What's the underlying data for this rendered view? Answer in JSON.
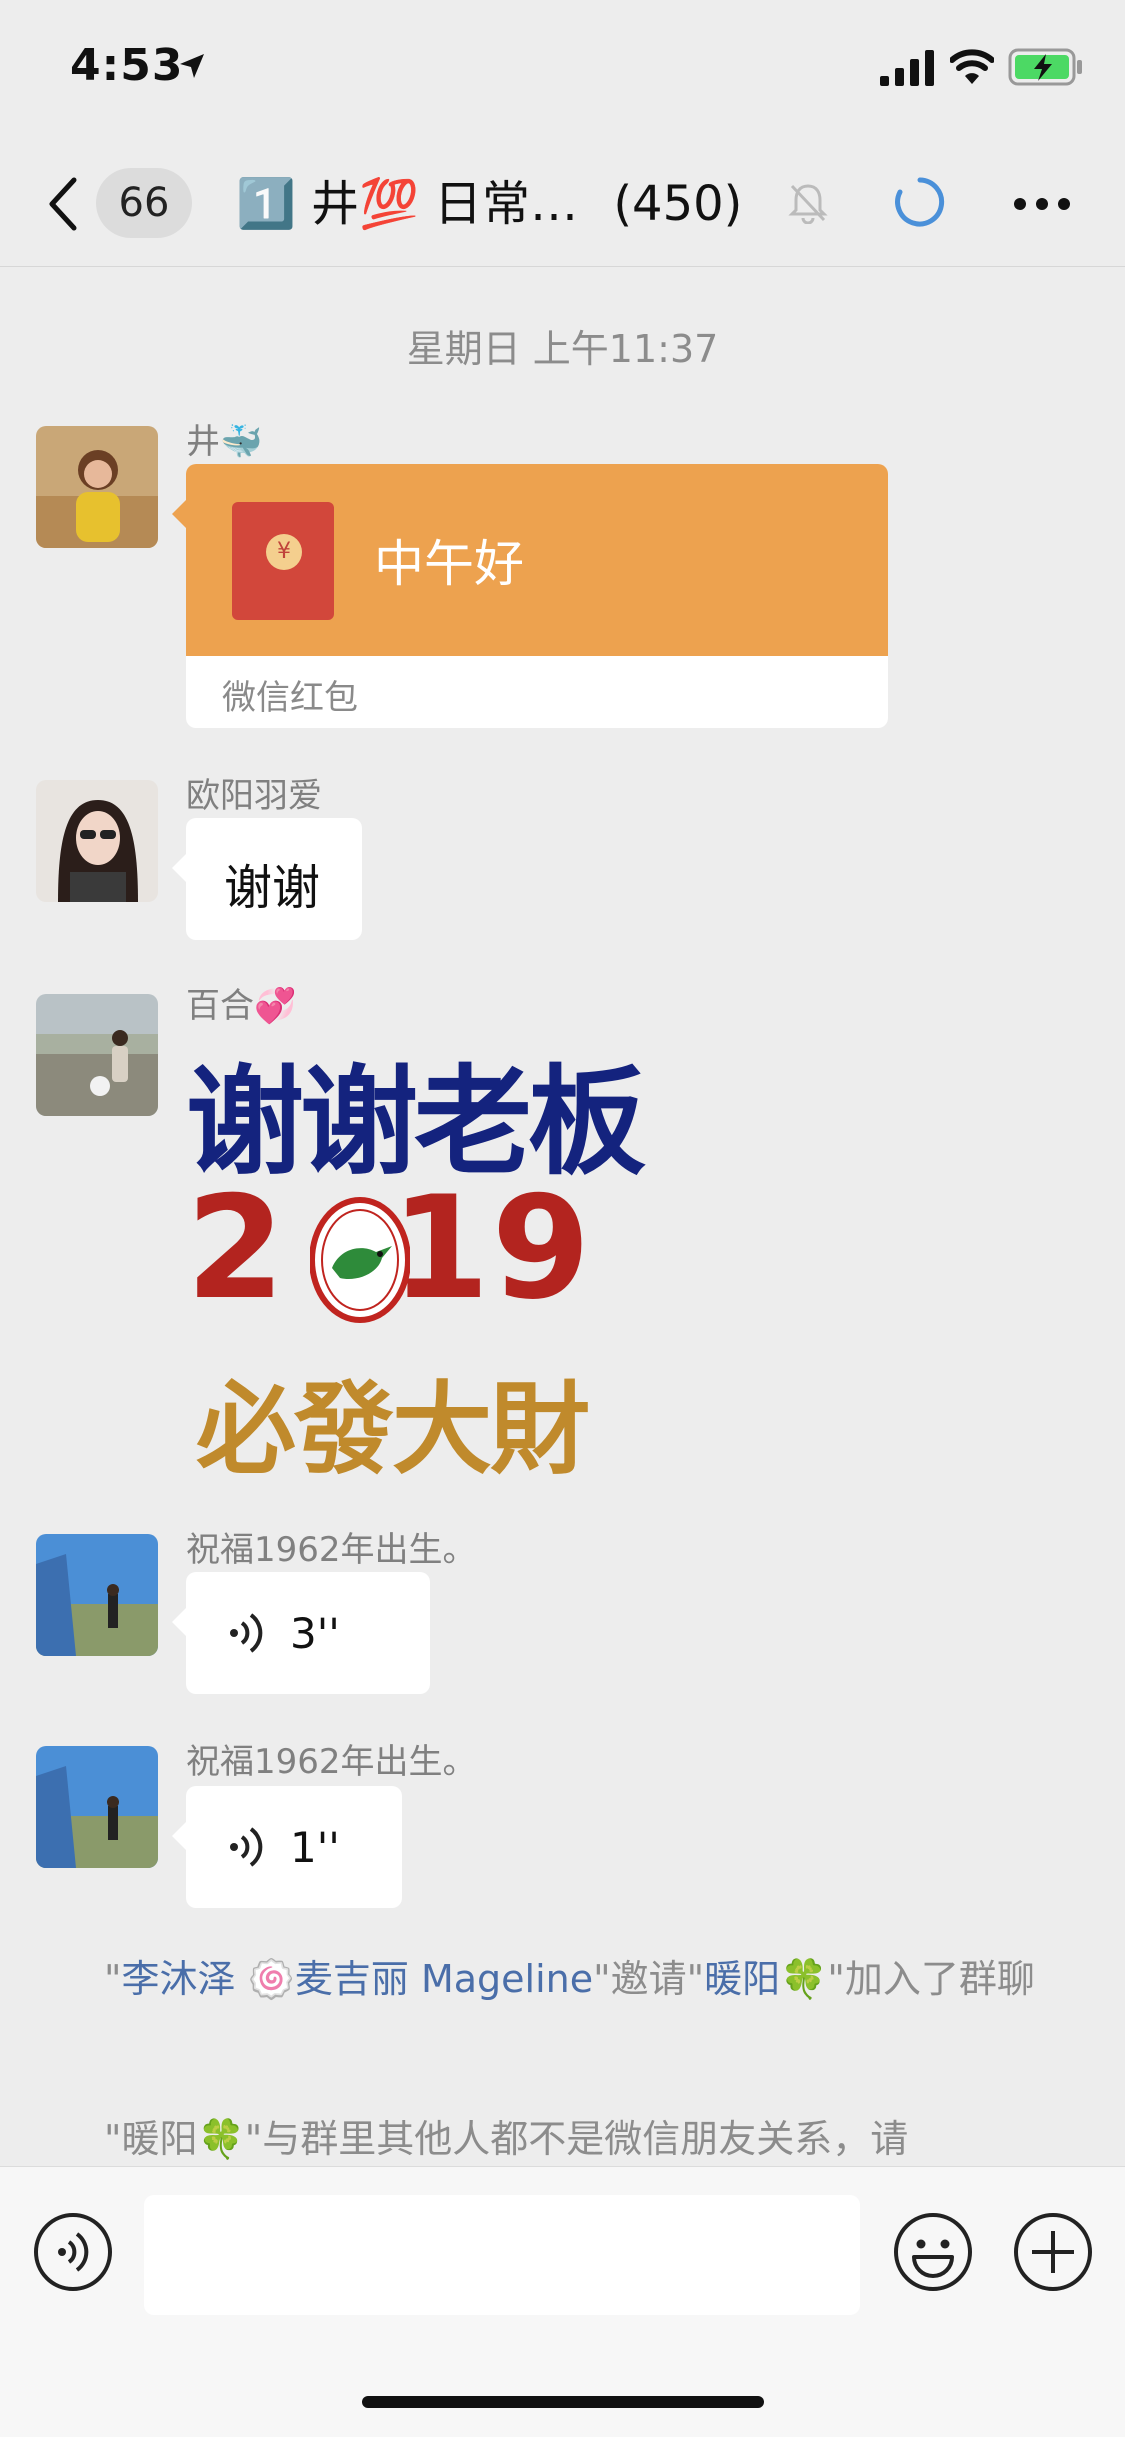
{
  "status_bar": {
    "time": "4:53"
  },
  "nav": {
    "unread_count": "66",
    "title": "1️⃣ 井💯 日常…",
    "member_count": "(450)"
  },
  "chat": {
    "timestamp": "星期日 上午11:37",
    "messages": [
      {
        "sender": "井🐳",
        "red_packet_text": "中午好",
        "red_packet_label": "微信红包"
      },
      {
        "sender": "欧阳羽爱",
        "text": "谢谢"
      },
      {
        "sender": "百合💞",
        "sticker_line1": "谢谢老板",
        "sticker_line2a": "2",
        "sticker_line2b": "19",
        "sticker_line3": "必發大財"
      },
      {
        "sender": "祝福1962年出生。",
        "voice_duration": "3''"
      },
      {
        "sender": "祝福1962年出生。",
        "voice_duration": "1''"
      }
    ],
    "system1": {
      "q1": "\"",
      "inviter": "李沐泽 🍥麦吉丽 Mageline",
      "mid": "\"邀请\"",
      "invitee": "暖阳🍀",
      "tail": "\"加入了群聊"
    },
    "system2": "\"暖阳🍀\"与群里其他人都不是微信朋友关系，请"
  },
  "colors": {
    "background": "#ededed",
    "red_packet": "#eda24f",
    "link": "#4a6ea9",
    "loading": "#4a90d9"
  }
}
